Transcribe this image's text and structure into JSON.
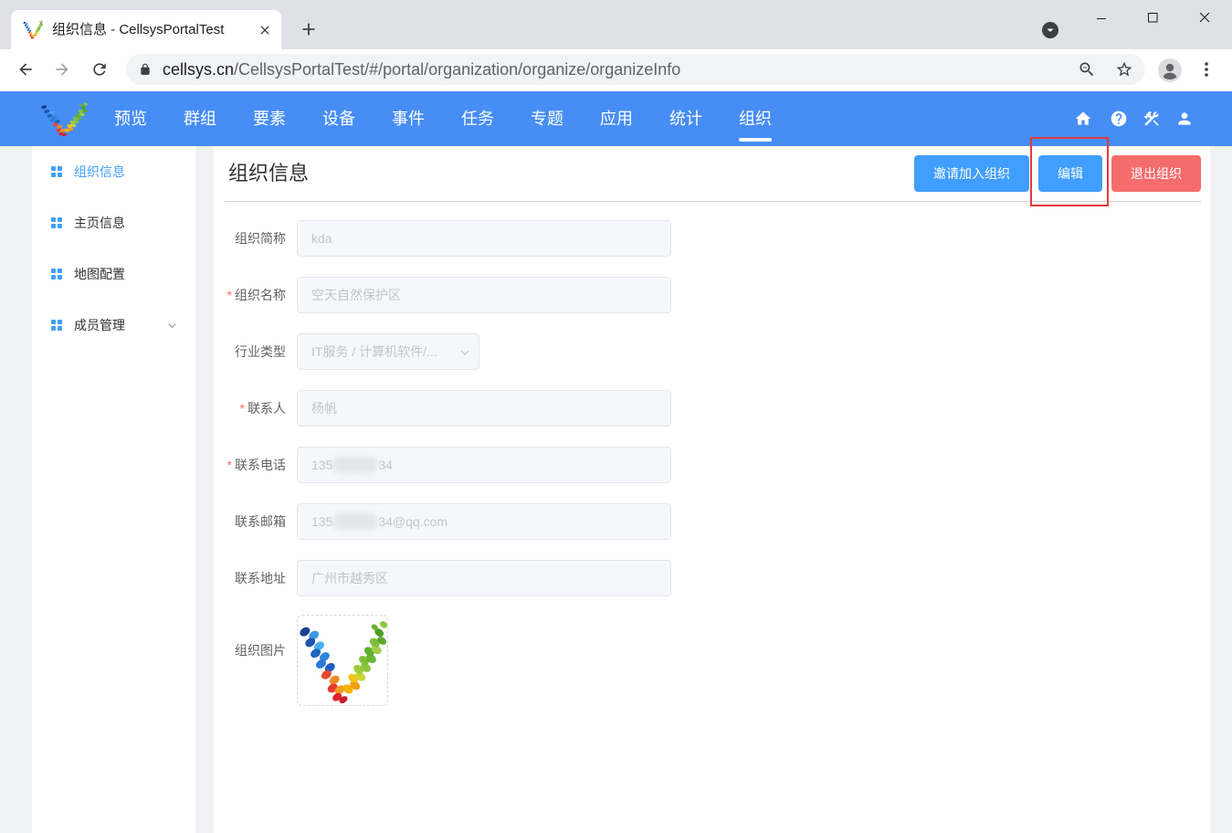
{
  "colors": {
    "tabstrip_bg": "#dee1e6",
    "header_bg": "#468df5",
    "primary": "#409eff",
    "danger": "#f56c6c",
    "highlight": "#e4393c",
    "page_bg": "#f0f2f5"
  },
  "browser": {
    "tab": {
      "title": "组织信息 - CellsysPortalTest",
      "favicon": "cellsys-logo",
      "close_icon": "close-icon"
    },
    "new_tab_icon": "plus-icon",
    "tab_search_icon": "chevron-down-circle-icon",
    "window_controls": [
      "minimize-icon",
      "maximize-icon",
      "window-close-icon"
    ],
    "nav_icons": [
      "back-arrow-icon",
      "forward-arrow-icon",
      "reload-icon"
    ],
    "url": {
      "lock_icon": "lock-icon",
      "host": "cellsys.cn",
      "path": "/CellsysPortalTest/#/portal/organization/organize/organizeInfo"
    },
    "omnibox_icons": [
      "zoom-out-icon",
      "star-icon"
    ],
    "profile_icon": "profile-avatar-icon",
    "menu_icon": "more-vertical-icon"
  },
  "header": {
    "logo": "cellsys-logo",
    "nav": [
      "预览",
      "群组",
      "要素",
      "设备",
      "事件",
      "任务",
      "专题",
      "应用",
      "统计",
      "组织"
    ],
    "active_nav_index": 9,
    "right_icons": [
      "home-icon",
      "help-icon",
      "tools-icon",
      "user-icon"
    ]
  },
  "sidebar": {
    "items": [
      {
        "label": "组织信息",
        "icon": "grid-icon",
        "active": true
      },
      {
        "label": "主页信息",
        "icon": "grid-icon"
      },
      {
        "label": "地图配置",
        "icon": "grid-icon"
      },
      {
        "label": "成员管理",
        "icon": "grid-icon",
        "expand_icon": "chevron-down-icon"
      }
    ]
  },
  "page": {
    "title": "组织信息",
    "actions": {
      "invite": "邀请加入组织",
      "edit": "编辑",
      "leave": "退出组织"
    }
  },
  "form": {
    "short_name": {
      "label": "组织简称",
      "value": "kda"
    },
    "name": {
      "required_mark": "*",
      "label": "组织名称",
      "value": "空天自然保护区"
    },
    "industry": {
      "label": "行业类型",
      "value": "IT服务 / 计算机软件/...",
      "icon": "chevron-down-icon"
    },
    "contact": {
      "required_mark": "*",
      "label": "联系人",
      "value": "杨帆"
    },
    "phone": {
      "required_mark": "*",
      "label": "联系电话",
      "value_prefix": "135",
      "value_suffix": "34"
    },
    "email": {
      "label": "联系邮箱",
      "value_prefix": "135",
      "value_suffix": "34@qq.com"
    },
    "address": {
      "label": "联系地址",
      "value": "广州市越秀区"
    },
    "image": {
      "label": "组织图片",
      "icon": "cellsys-logo"
    }
  }
}
